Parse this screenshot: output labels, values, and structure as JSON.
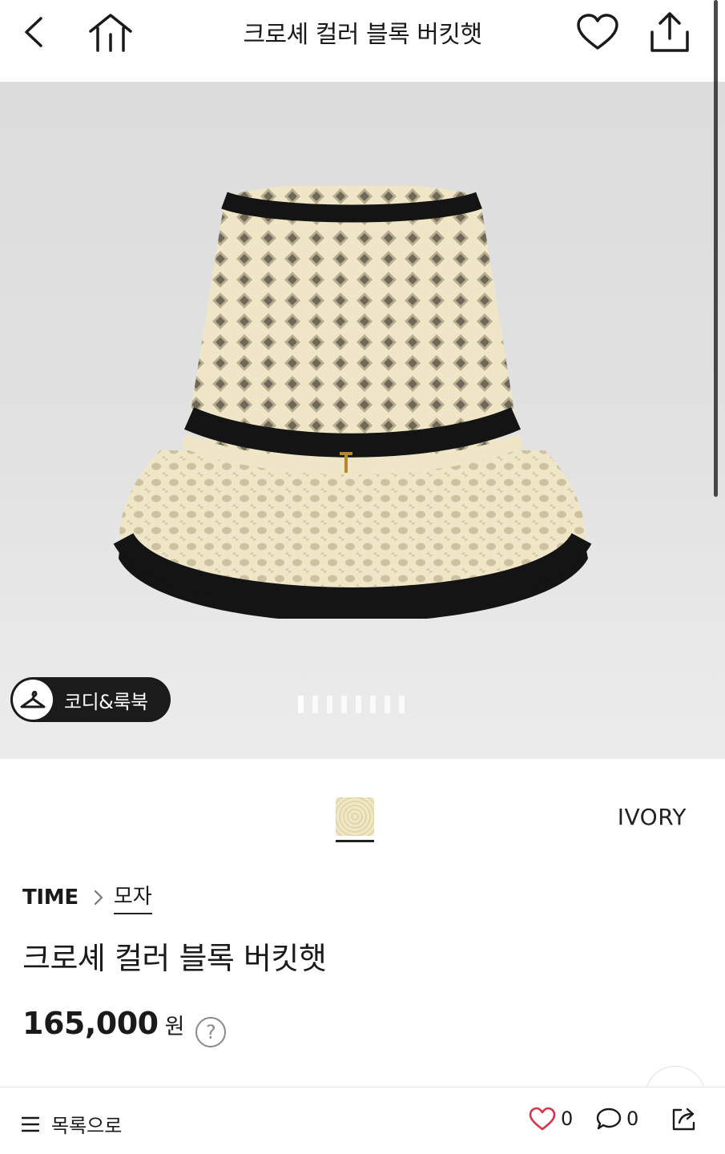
{
  "header": {
    "title": "크로셰 컬러 블록 버킷햇",
    "back_icon": "chevron-left-icon",
    "home_icon": "home-icon",
    "wishlist_icon": "heart-icon",
    "share_icon": "share-upload-icon"
  },
  "gallery": {
    "coordi_label": "코디&룩북",
    "image_count": 8,
    "current_index": 1
  },
  "color_selector": {
    "selected_color": "IVORY"
  },
  "product": {
    "brand": "TIME",
    "category": "모자",
    "name": "크로셰 컬러 블록 버킷햇",
    "price": "165,000",
    "price_unit": "원",
    "help_symbol": "?"
  },
  "bottom_bar": {
    "list_label": "목록으로",
    "like_count": "0",
    "comment_count": "0"
  },
  "colors": {
    "accent_like": "#d6334a",
    "text": "#1a1a1a",
    "hero_bg": "#e0e0e0",
    "hat_ivory": "#efe6c8",
    "hat_trim": "#141414"
  }
}
